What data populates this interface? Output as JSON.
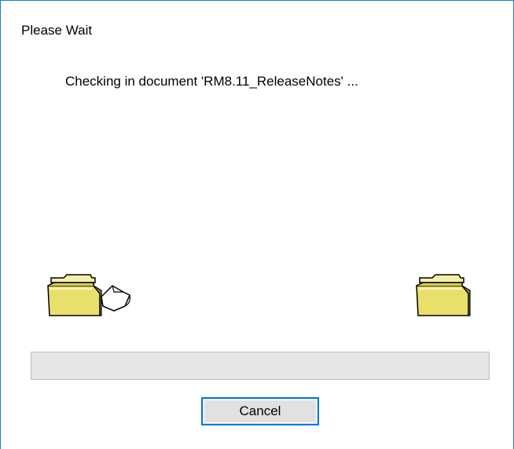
{
  "dialog": {
    "title": "Please Wait",
    "message": "Checking in document 'RM8.11_ReleaseNotes' ...",
    "progress_percent": 0,
    "cancel_label": "Cancel"
  },
  "icons": {
    "source": "folder-icon",
    "document": "document-icon",
    "destination": "folder-icon"
  },
  "colors": {
    "accent": "#0078d7",
    "window_border": "#1c7ad6",
    "folder": "#e8e06a",
    "progress_track": "#e6e6e6",
    "button_face": "#e1e1e1"
  }
}
